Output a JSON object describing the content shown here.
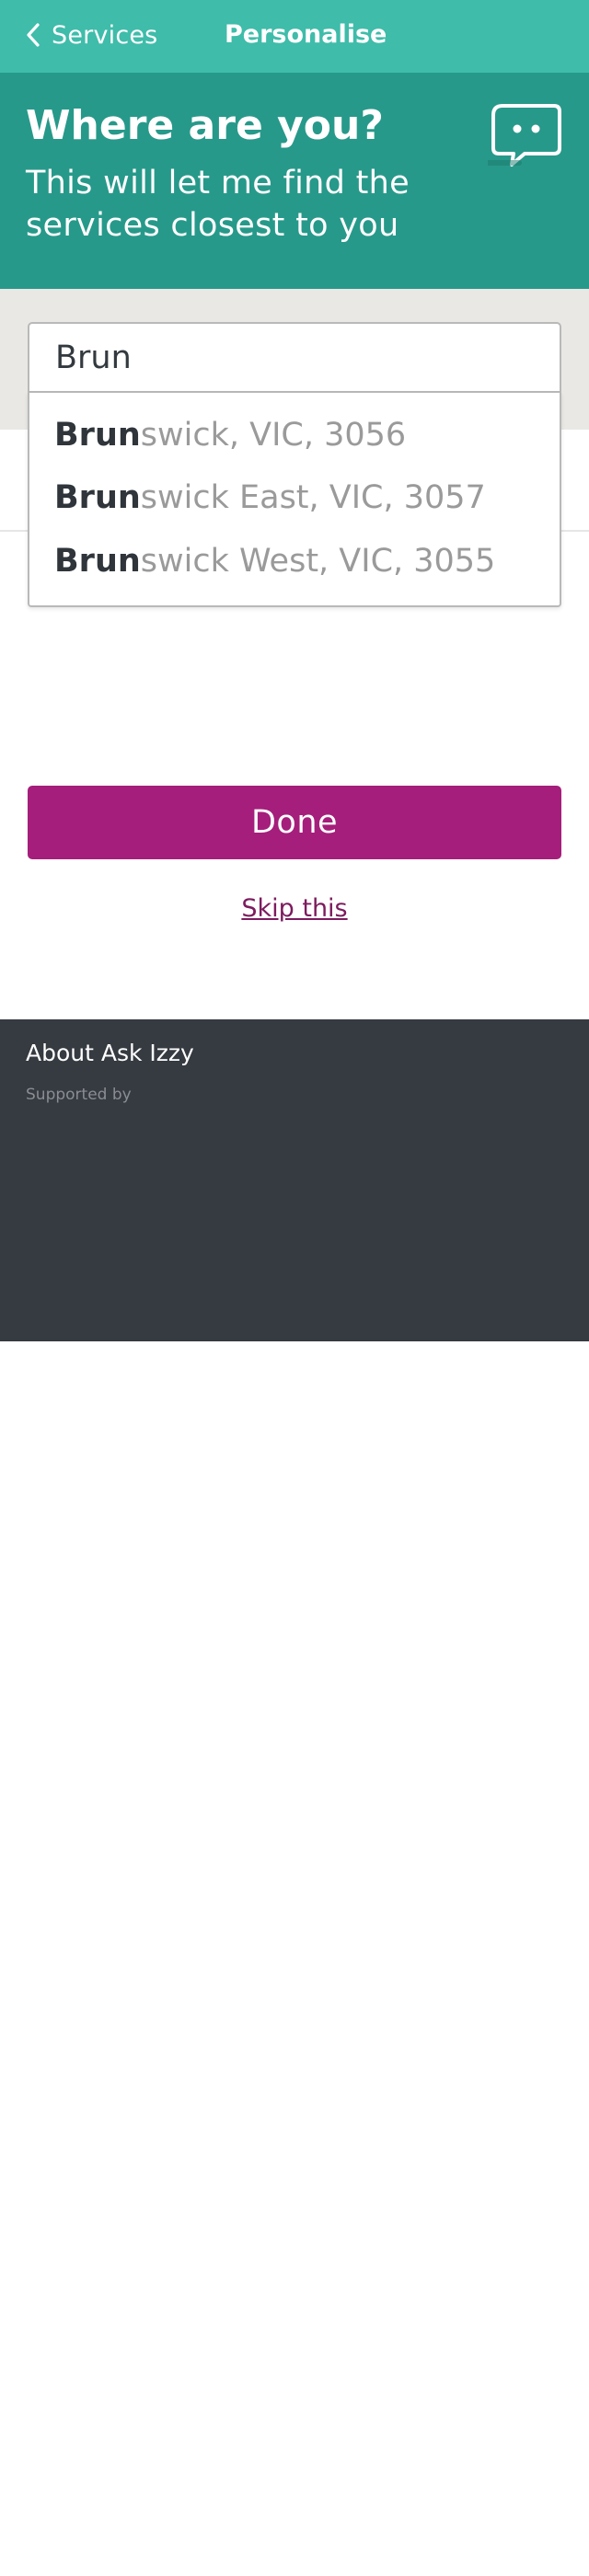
{
  "nav": {
    "back_label": "Services",
    "title": "Personalise"
  },
  "banner": {
    "heading": "Where are you?",
    "body": "This will let me find the services closest to you",
    "icon": "chat-bubble-face-icon"
  },
  "search": {
    "value": "Brun",
    "suggestions": [
      {
        "match": "Brun",
        "rest": "swick, VIC, 3056"
      },
      {
        "match": "Brun",
        "rest": "swick East, VIC, 3057"
      },
      {
        "match": "Brun",
        "rest": "swick West, VIC, 3055"
      }
    ]
  },
  "actions": {
    "done_label": "Done",
    "skip_label": "Skip this"
  },
  "footer": {
    "about_label": "About Ask Izzy",
    "supported_by": "Supported by"
  },
  "colors": {
    "nav_bg": "#3fbcaa",
    "banner_bg": "#27998a",
    "strip_bg": "#e9e8e4",
    "primary_button": "#a51e7b",
    "link": "#7c1c5e",
    "footer_bg": "#363a41"
  }
}
